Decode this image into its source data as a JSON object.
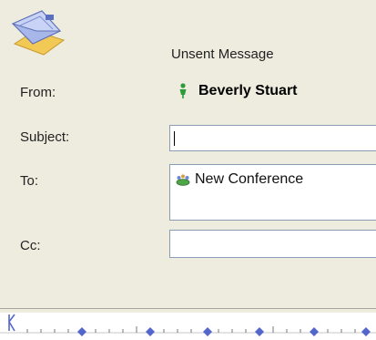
{
  "header": {
    "status_text": "Unsent Message",
    "icon": "envelope-icon"
  },
  "form": {
    "from_label": "From:",
    "from_value": "Beverly Stuart",
    "subject_label": "Subject:",
    "subject_value": "",
    "to_label": "To:",
    "to_recipient": "New Conference",
    "cc_label": "Cc:",
    "cc_value": ""
  },
  "ruler": {
    "icon": "ruler-icon"
  }
}
